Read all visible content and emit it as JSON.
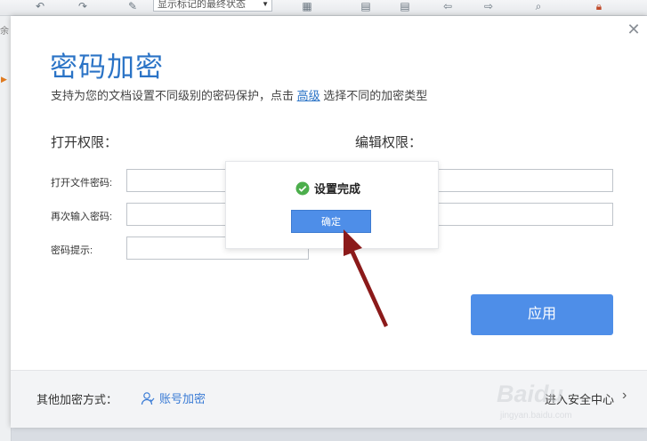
{
  "toolbar": {
    "select_value": "显示标记的最终状态",
    "icons": [
      "undo-icon",
      "redo-icon",
      "edit-icon",
      "document-check-icon",
      "page-icon",
      "page-icon-2",
      "back-icon",
      "forward-icon",
      "search-icon",
      "lock-icon"
    ]
  },
  "left_strip": {
    "glyph": "余"
  },
  "dialog": {
    "title": "密码加密",
    "subtitle_before": "支持为您的文档设置不同级别的密码保护，点击 ",
    "subtitle_link": "高级",
    "subtitle_after": " 选择不同的加密类型",
    "open_section": "打开权限：",
    "edit_section": "编辑权限：",
    "open_password_label": "打开文件密码:",
    "reenter_password_label": "再次输入密码:",
    "hint_label": "密码提示:",
    "apply_button": "应用",
    "close_icon": "close-icon"
  },
  "footer": {
    "other_methods_label": "其他加密方式：",
    "account_encrypt_link": "账号加密",
    "security_center_link": "进入安全中心"
  },
  "popup": {
    "message": "设置完成",
    "confirm_button": "确定"
  },
  "watermark": {
    "logo_text": "Baidu",
    "sub_text": "jingyan.baidu.com"
  },
  "colors": {
    "accent": "#4e8ee8",
    "title_blue": "#2a73c6",
    "success_green": "#4cae4c",
    "arrow_red": "#8b1a1a"
  }
}
